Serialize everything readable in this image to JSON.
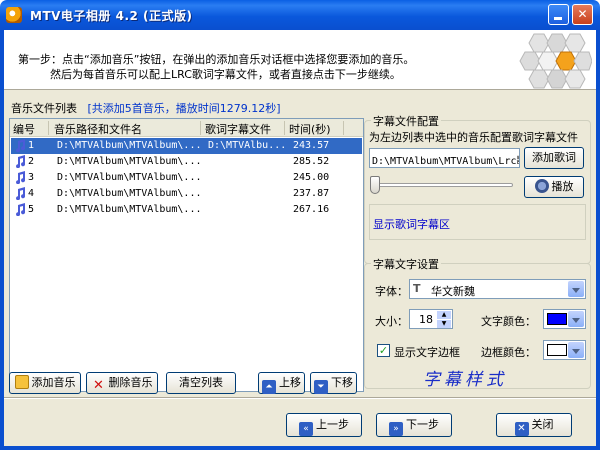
{
  "window": {
    "title": "MTV电子相册 4.2  (正式版)",
    "controls": {
      "minimize": "_",
      "close": "✕"
    }
  },
  "header": {
    "line1": "第一步：点击“添加音乐”按钮，在弹出的添加音乐对话框中选择您要添加的音乐。",
    "line2": "然后为每首音乐可以配上LRC歌词字幕文件，或者直接点击下一步继续。"
  },
  "music_list": {
    "title": "音乐文件列表",
    "info": "[共添加5首音乐，播放时间1279.12秒]",
    "columns": [
      "编号",
      "音乐路径和文件名",
      "歌词字幕文件",
      "时间(秒)"
    ],
    "rows": [
      {
        "no": "1",
        "path": "D:\\MTVAlbum\\MTVAlbum\\...",
        "lyric": "D:\\MTVAlbu...",
        "time": "243.57",
        "selected": true
      },
      {
        "no": "2",
        "path": "D:\\MTVAlbum\\MTVAlbum\\...",
        "lyric": "",
        "time": "285.52",
        "selected": false
      },
      {
        "no": "3",
        "path": "D:\\MTVAlbum\\MTVAlbum\\...",
        "lyric": "",
        "time": "245.00",
        "selected": false
      },
      {
        "no": "4",
        "path": "D:\\MTVAlbum\\MTVAlbum\\...",
        "lyric": "",
        "time": "237.87",
        "selected": false
      },
      {
        "no": "5",
        "path": "D:\\MTVAlbum\\MTVAlbum\\...",
        "lyric": "",
        "time": "267.16",
        "selected": false
      }
    ]
  },
  "list_buttons": {
    "add": "添加音乐",
    "delete": "删除音乐",
    "clear": "清空列表",
    "up": "上移",
    "down": "下移"
  },
  "lyric_config": {
    "legend": "字幕文件配置",
    "hint": "为左边列表中选中的音乐配置歌词字幕文件",
    "path_value": "D:\\MTVAlbum\\MTVAlbum\\Lrc歌",
    "add_button": "添加歌词",
    "play_button": "播放",
    "slider_value": 0,
    "display_area": "显示歌词字幕区"
  },
  "text_settings": {
    "legend": "字幕文字设置",
    "font_label": "字体：",
    "font_value": "华文新魏",
    "size_label": "大小：",
    "size_value": "18",
    "text_color_label": "文字颜色：",
    "text_color": "#0000ff",
    "show_border_label": "显示文字边框",
    "show_border_checked": true,
    "border_color_label": "边框颜色：",
    "border_color": "#ffffff",
    "sample_text": "字幕样式"
  },
  "nav": {
    "prev": "上一步",
    "next": "下一步",
    "close": "关闭"
  }
}
